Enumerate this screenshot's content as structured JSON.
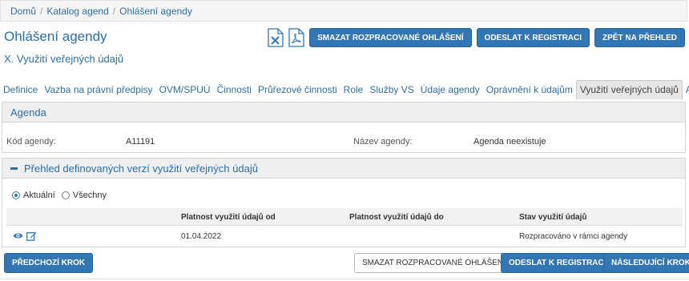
{
  "breadcrumb": {
    "items": [
      "Domů",
      "Katalog agend",
      "Ohlášení agendy"
    ],
    "separator": "/"
  },
  "header": {
    "title": "Ohlášení agendy",
    "subtitle": "X. Využití veřejných údajů"
  },
  "top_actions": {
    "excel_icon": "excel-icon",
    "pdf_icon": "pdf-icon",
    "delete_draft": "SMAZAT ROZPRACOVANÉ OHLÁŠENÍ",
    "submit": "ODESLAT K REGISTRACI",
    "back": "ZPĚT NA PŘEHLED"
  },
  "tabs": [
    {
      "label": "Definice"
    },
    {
      "label": "Vazba na právní předpisy"
    },
    {
      "label": "OVM/SPUÚ"
    },
    {
      "label": "Činnosti"
    },
    {
      "label": "Průřezové činnosti"
    },
    {
      "label": "Role"
    },
    {
      "label": "Služby VS"
    },
    {
      "label": "Údaje agendy"
    },
    {
      "label": "Oprávnění k údajům"
    },
    {
      "label": "Využití veřejných údajů",
      "active": true
    },
    {
      "label": "AIS"
    }
  ],
  "agenda_panel": {
    "title": "Agenda",
    "code_label": "Kód agendy:",
    "code_value": "A11191",
    "name_label": "Název agendy:",
    "name_value": "Agenda neexistuje"
  },
  "versions_panel": {
    "title": "Přehled definovaných verzí využití veřejných údajů",
    "radio_current": "Aktuální",
    "radio_all": "Všechny",
    "selected": "Aktuální",
    "columns": [
      "Platnost využití údajů od",
      "Platnost využití údajů do",
      "Stav využití údajů"
    ],
    "rows": [
      {
        "from": "01.04.2022",
        "to": "",
        "state": "Rozpracováno v rámci agendy"
      }
    ]
  },
  "bottom_actions": {
    "prev": "PŘEDCHOZÍ KROK",
    "delete_draft": "SMAZAT ROZPRACOVANÉ OHLÁŠENÍ",
    "submit": "ODESLAT K REGISTRACI",
    "next": "NÁSLEDUJÍCÍ KROK"
  },
  "colors": {
    "accent": "#3277b3",
    "link": "#2d6ea5",
    "panel_header": "#efefef"
  }
}
